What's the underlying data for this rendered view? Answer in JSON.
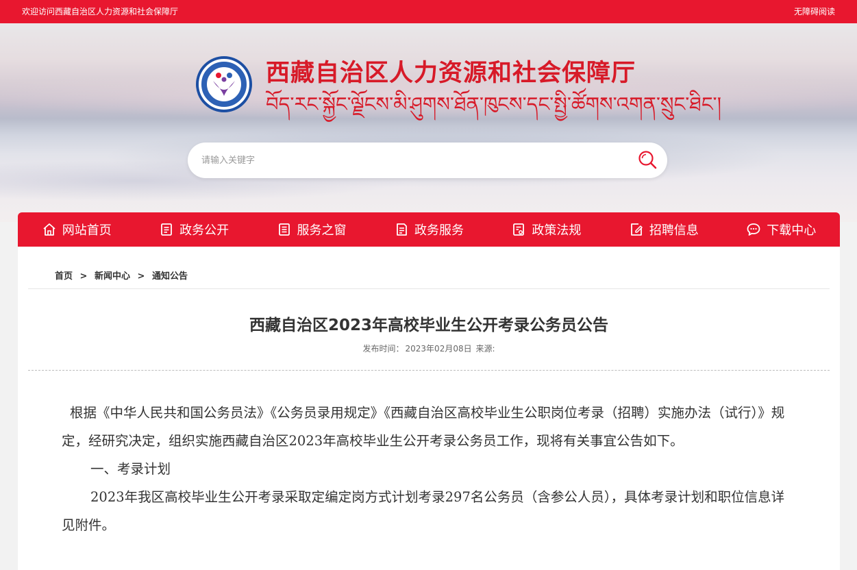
{
  "topbar": {
    "welcome": "欢迎访问西藏自治区人力资源和社会保障厅",
    "accessibility": "无障碍阅读"
  },
  "header": {
    "org_name": "西藏自治区人力资源和社会保障厅",
    "org_name_tibetan": "བོད་རང་སྐྱོང་ལྗོངས་མི་ཤུགས་ཐོན་ཁུངས་དང་སྤྱི་ཚོགས་འགན་སྲུང་ཐིང་།"
  },
  "search": {
    "placeholder": "请输入关键字"
  },
  "nav": {
    "items": [
      {
        "label": "网站首页",
        "icon": "home-icon"
      },
      {
        "label": "政务公开",
        "icon": "document-icon"
      },
      {
        "label": "服务之窗",
        "icon": "list-doc-icon"
      },
      {
        "label": "政务服务",
        "icon": "form-icon"
      },
      {
        "label": "政策法规",
        "icon": "law-doc-icon"
      },
      {
        "label": "招聘信息",
        "icon": "edit-doc-icon"
      },
      {
        "label": "下载中心",
        "icon": "chat-icon"
      }
    ]
  },
  "breadcrumb": {
    "home": "首页",
    "sep": ">",
    "news": "新闻中心",
    "current": "通知公告"
  },
  "article": {
    "title": "西藏自治区2023年高校毕业生公开考录公务员公告",
    "date_label": "发布时间：",
    "date": "2023年02月08日",
    "source_label": "来源:",
    "paragraphs": [
      "根据《中华人民共和国公务员法》《公务员录用规定》《西藏自治区高校毕业生公职岗位考录（招聘）实施办法（试行）》规定，经研究决定，组织实施西藏自治区2023年高校毕业生公开考录公务员工作，现将有关事宜公告如下。",
      "一、考录计划",
      "2023年我区高校毕业生公开考录采取定编定岗方式计划考录297名公务员（含参公人员），具体考录计划和职位信息详见附件。"
    ]
  },
  "colors": {
    "brand_red": "#e8172f",
    "title_red": "#d71a28",
    "logo_blue": "#1d4fa3"
  }
}
